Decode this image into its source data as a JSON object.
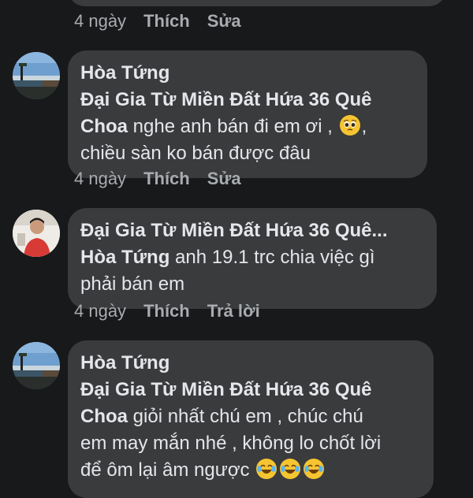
{
  "comments": [
    {
      "time": "4 ngày",
      "actions": [
        "Thích",
        "Sửa"
      ]
    },
    {
      "author": "Hòa Tứng",
      "tag_line1": "Đại Gia Từ Miền Đất Hứa 36 Quê",
      "tag_line2": "Choa",
      "text_a": " nghe anh bán đi em ơi , ",
      "emoji": "pleading-face-icon",
      "text_b": ",",
      "text_line3": "chiều sàn ko bán được đâu",
      "time": "4 ngày",
      "actions": [
        "Thích",
        "Sửa"
      ]
    },
    {
      "author": "Đại Gia Từ Miền Đất Hứa 36 Quê...",
      "tag": "Hòa Tứng",
      "text_a": " anh 19.1 trc chia việc gì",
      "text_line3": "phải bán em",
      "time": "4 ngày",
      "actions": [
        "Thích",
        "Trả lời"
      ]
    },
    {
      "author": "Hòa Tứng",
      "tag_line1": "Đại Gia Từ Miền Đất Hứa 36 Quê",
      "tag_line2": "Choa",
      "text_a": " giỏi nhất chú em , chúc chú",
      "text_line3": "em may mắn nhé , không lo chốt lời",
      "text_line4": "để ôm lại âm ngược ",
      "emoji": "tears-of-joy-icon"
    }
  ],
  "colors": {
    "background": "#18191a",
    "bubble": "#3a3b3c",
    "text": "#e4e6eb",
    "muted": "#a8abaf"
  }
}
